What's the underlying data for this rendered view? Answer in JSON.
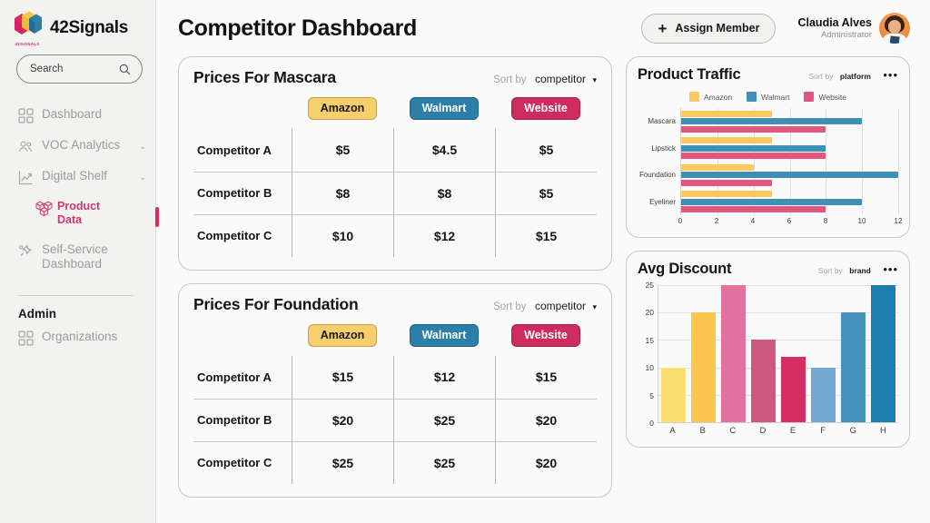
{
  "brand": {
    "name": "42Signals",
    "logo_caption": "42SIGNALS"
  },
  "search": {
    "placeholder": "Search",
    "value": "Search",
    "icon": "search-icon"
  },
  "sidebar": {
    "items": [
      {
        "label": "Dashboard",
        "icon": "grid-icon",
        "chevron": ""
      },
      {
        "label": "VOC Analytics",
        "icon": "people-icon",
        "chevron": "⌄"
      },
      {
        "label": "Digital Shelf",
        "icon": "line-chart-icon",
        "chevron": "⌄"
      },
      {
        "label": "Product Data",
        "icon": "boxes-icon",
        "active": true
      },
      {
        "label": "Self-Service Dashboard",
        "icon": "tools-icon",
        "chevron": ""
      }
    ],
    "admin_section": {
      "title": "Admin",
      "items": [
        {
          "label": "Organizations",
          "icon": "grid-icon"
        }
      ]
    },
    "active_color": "#cf3a6c"
  },
  "header": {
    "title": "Competitor Dashboard",
    "assign_button": {
      "label": "Assign Member",
      "icon": "plus-icon"
    },
    "user": {
      "name": "Claudia Alves",
      "role": "Administrator",
      "avatar": "avatar-image"
    }
  },
  "price_tables": [
    {
      "title": "Prices For Mascara",
      "sort_label": "Sort by",
      "sort_value": "competitor",
      "caret": "▾",
      "columns": [
        {
          "label": "Amazon",
          "bg": "#f7ce6c",
          "fg": "#15181d"
        },
        {
          "label": "Walmart",
          "bg": "#2b7fa8",
          "fg": "#ffffff"
        },
        {
          "label": "Website",
          "bg": "#ce2b5e",
          "fg": "#ffffff"
        }
      ],
      "rows": [
        {
          "name": "Competitor A",
          "values": [
            "$5",
            "$4.5",
            "$5"
          ]
        },
        {
          "name": "Competitor B",
          "values": [
            "$8",
            "$8",
            "$5"
          ]
        },
        {
          "name": "Competitor C",
          "values": [
            "$10",
            "$12",
            "$15"
          ]
        }
      ]
    },
    {
      "title": "Prices For Foundation",
      "sort_label": "Sort by",
      "sort_value": "competitor",
      "caret": "▾",
      "columns": [
        {
          "label": "Amazon",
          "bg": "#f7ce6c",
          "fg": "#15181d"
        },
        {
          "label": "Walmart",
          "bg": "#2b7fa8",
          "fg": "#ffffff"
        },
        {
          "label": "Website",
          "bg": "#ce2b5e",
          "fg": "#ffffff"
        }
      ],
      "rows": [
        {
          "name": "Competitor A",
          "values": [
            "$15",
            "$12",
            "$15"
          ]
        },
        {
          "name": "Competitor B",
          "values": [
            "$20",
            "$25",
            "$20"
          ]
        },
        {
          "name": "Competitor C",
          "values": [
            "$25",
            "$25",
            "$20"
          ]
        }
      ]
    }
  ],
  "traffic_card": {
    "title": "Product Traffic",
    "sort_label": "Sort by",
    "sort_value": "platform",
    "dots": "•••"
  },
  "discount_card": {
    "title": "Avg Discount",
    "sort_label": "Sort by",
    "sort_value": "brand",
    "dots": "•••"
  },
  "chart_data": [
    {
      "type": "bar",
      "orientation": "horizontal",
      "title": "Product Traffic",
      "categories": [
        "Mascara",
        "Lipstick",
        "Foundation",
        "Eyeliner"
      ],
      "series": [
        {
          "name": "Amazon",
          "color": "#fbc95f",
          "values": [
            5,
            5,
            4,
            5
          ]
        },
        {
          "name": "Walmart",
          "color": "#4090b5",
          "values": [
            10,
            8,
            12,
            10
          ]
        },
        {
          "name": "Website",
          "color": "#e05880",
          "values": [
            8,
            8,
            5,
            8
          ]
        }
      ],
      "xlabel": "",
      "ylabel": "",
      "xticks": [
        0,
        2,
        4,
        6,
        8,
        10,
        12
      ],
      "xlim": [
        0,
        12
      ],
      "grid": true,
      "legend": "top-center"
    },
    {
      "type": "bar",
      "orientation": "vertical",
      "title": "Avg Discount",
      "categories": [
        "A",
        "B",
        "C",
        "D",
        "E",
        "F",
        "G",
        "H"
      ],
      "values": [
        10,
        20,
        25,
        15,
        12,
        10,
        20,
        25
      ],
      "colors": [
        "#fbdf72",
        "#fcc54d",
        "#e2729e",
        "#cd5980",
        "#d52e63",
        "#73a8d1",
        "#4592be",
        "#1c7fae"
      ],
      "xlabel": "",
      "ylabel": "",
      "yticks": [
        0,
        5,
        10,
        15,
        20,
        25
      ],
      "ylim": [
        0,
        25
      ],
      "grid": true,
      "legend": "none"
    }
  ]
}
